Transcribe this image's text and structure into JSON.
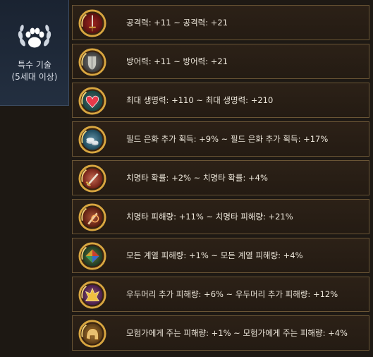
{
  "category": {
    "line1": "특수 기술",
    "line2": "(5세대 이상)",
    "icon": "paw-laurel-icon"
  },
  "skills": [
    {
      "label": "공격력: +11 ~ 공격력: +21",
      "icon": "sword-icon",
      "bg": "#8a1a1a",
      "inner": "#c63a2a"
    },
    {
      "label": "방어력: +11 ~ 방어력: +21",
      "icon": "shield-icon",
      "bg": "#5b5b5b",
      "inner": "#a8a8a0"
    },
    {
      "label": "최대 생명력: +110 ~ 최대 생명력: +210",
      "icon": "heart-icon",
      "bg": "#1c6e6a",
      "inner": "#e04050"
    },
    {
      "label": "필드 은화 추가 획득: +9% ~ 필드 은화 추가 획득: +17%",
      "icon": "coins-icon",
      "bg": "#2a6d8a",
      "inner": "#c9d3d8"
    },
    {
      "label": "치명타 확률: +2% ~ 치명타 확률: +4%",
      "icon": "critical-sword-icon",
      "bg": "#b03020",
      "inner": "#e8d0b0"
    },
    {
      "label": "치명타 피해량: +11% ~ 치명타 피해량: +21%",
      "icon": "critical-damage-icon",
      "bg": "#8a2a18",
      "inner": "#e0a070"
    },
    {
      "label": "모든 계열 피해량: +1% ~ 모든 계열 피해량: +4%",
      "icon": "elements-icon",
      "bg": "#2a5a3a",
      "inner": "#d0a030"
    },
    {
      "label": "우두머리 추가 피해량: +6% ~ 우두머리 추가 피해량: +12%",
      "icon": "boss-icon",
      "bg": "#6a2a7a",
      "inner": "#f0c040"
    },
    {
      "label": "모험가에게 주는 피해량: +1% ~ 모험가에게 주는 피해량: +4%",
      "icon": "helmet-icon",
      "bg": "#8a5a20",
      "inner": "#e8c070"
    }
  ],
  "colors": {
    "ring": "#d8a640",
    "row_border": "#6a5535",
    "text": "#ece6da"
  }
}
